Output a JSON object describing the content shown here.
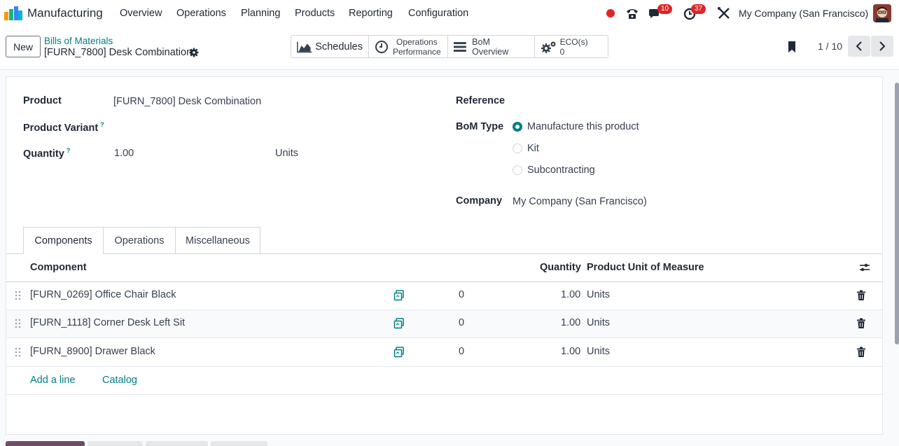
{
  "navbar": {
    "app_name": "Manufacturing",
    "menus": [
      "Overview",
      "Operations",
      "Planning",
      "Products",
      "Reporting",
      "Configuration"
    ],
    "messages_badge": "10",
    "activities_badge": "37",
    "company": "My Company (San Francisco)"
  },
  "control_panel": {
    "new_label": "New",
    "breadcrumb_parent": "Bills of Materials",
    "breadcrumb_current": "[FURN_7800] Desk Combination",
    "smart_buttons": {
      "schedules": "Schedules",
      "ops_perf_line1": "Operations",
      "ops_perf_line2": "Performance",
      "bom_overview": "BoM Overview",
      "eco_label": "ECO(s)",
      "eco_count": "0"
    },
    "pager": "1 / 10"
  },
  "form": {
    "product_label": "Product",
    "product_value": "[FURN_7800] Desk Combination",
    "variant_label": "Product Variant",
    "quantity_label": "Quantity",
    "quantity_value": "1.00",
    "quantity_uom": "Units",
    "help_mark": "?",
    "reference_label": "Reference",
    "bom_type_label": "BoM Type",
    "bom_types": [
      "Manufacture this product",
      "Kit",
      "Subcontracting"
    ],
    "bom_type_selected": "Manufacture this product",
    "company_label": "Company",
    "company_value": "My Company (San Francisco)"
  },
  "tabs": [
    "Components",
    "Operations",
    "Miscellaneous"
  ],
  "table": {
    "headers": {
      "component": "Component",
      "quantity": "Quantity",
      "uom": "Product Unit of Measure"
    },
    "rows": [
      {
        "component": "[FURN_0269] Office Chair Black",
        "avail": "0",
        "quantity": "1.00",
        "uom": "Units"
      },
      {
        "component": "[FURN_1118] Corner Desk Left Sit",
        "avail": "0",
        "quantity": "1.00",
        "uom": "Units"
      },
      {
        "component": "[FURN_8900] Drawer Black",
        "avail": "0",
        "quantity": "1.00",
        "uom": "Units"
      }
    ],
    "add_line": "Add a line",
    "catalog": "Catalog"
  },
  "colors": {
    "accent": "#017e84",
    "badge": "#dc2626",
    "brand_primary": "#714b67"
  }
}
